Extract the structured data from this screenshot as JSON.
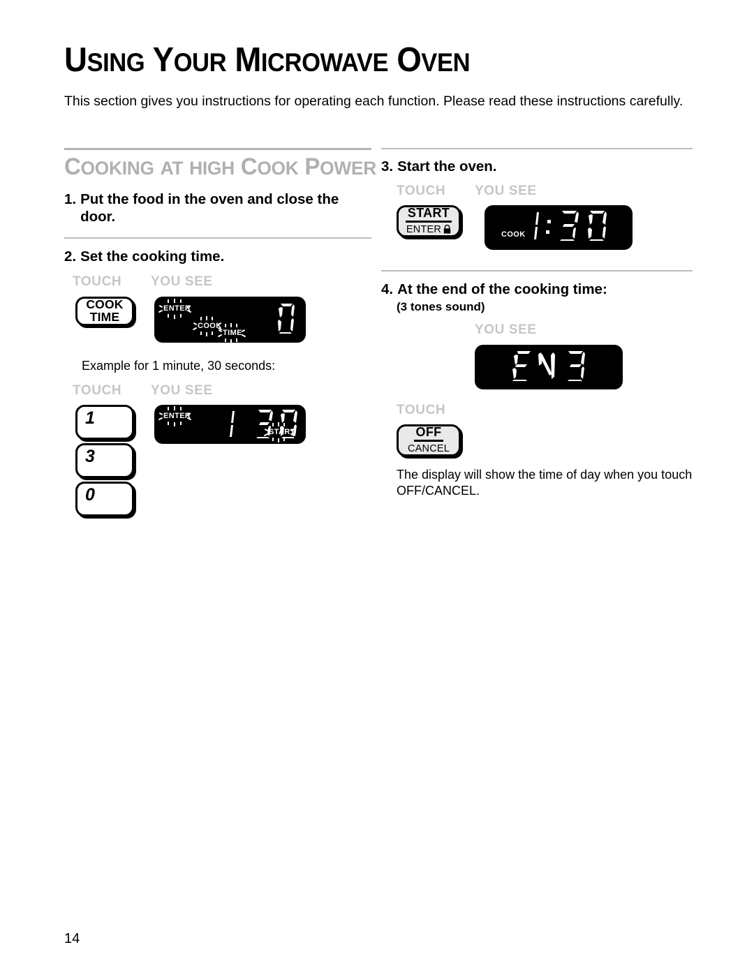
{
  "document": {
    "title_words": [
      "Using",
      "Your",
      "Microwave",
      "Oven"
    ],
    "title_plain": "USING YOUR MICROWAVE OVEN",
    "intro": "This section gives you instructions for operating each function. Please read these instructions carefully.",
    "page_number": "14"
  },
  "section": {
    "heading_words": [
      "Cooking",
      "at",
      "high",
      "cook",
      "power"
    ],
    "heading_plain": "COOKING AT HIGH COOK POWER",
    "heading_color": "#b0b0b0"
  },
  "labels": {
    "touch": "TOUCH",
    "you_see": "YOU SEE",
    "label_color": "#c6c6c6"
  },
  "steps": {
    "step1": {
      "number": "1.",
      "text": "Put the food in the oven and close the door."
    },
    "step2": {
      "number": "2.",
      "text": "Set the cooking time.",
      "key_label_line1": "COOK",
      "key_label_line2": "TIME",
      "display": {
        "digits": "0",
        "flashing": [
          "ENTER",
          "COOK",
          "TIME"
        ]
      },
      "example_caption": "Example for 1 minute, 30 seconds:",
      "number_keys": [
        "1",
        "3",
        "0"
      ],
      "example_display": {
        "digits": "1 30",
        "digit_minutes": "1",
        "digit_seconds": "30",
        "flashing": [
          "ENTER",
          "START"
        ]
      }
    },
    "step3": {
      "number": "3.",
      "text": "Start the oven.",
      "key_top": "START",
      "key_bottom": "ENTER",
      "key_icon": "padlock-icon",
      "display": {
        "digits": "1:30",
        "digit_minutes": "1",
        "digit_seconds": "30",
        "annunciator": "COOK"
      }
    },
    "step4": {
      "number": "4.",
      "text": "At the end of the cooking time:",
      "subnote": "(3 tones sound)",
      "display": {
        "digits": "END"
      },
      "key_top": "OFF",
      "key_bottom": "CANCEL",
      "closing_note": "The display will show the time of day when you touch OFF/CANCEL."
    }
  }
}
